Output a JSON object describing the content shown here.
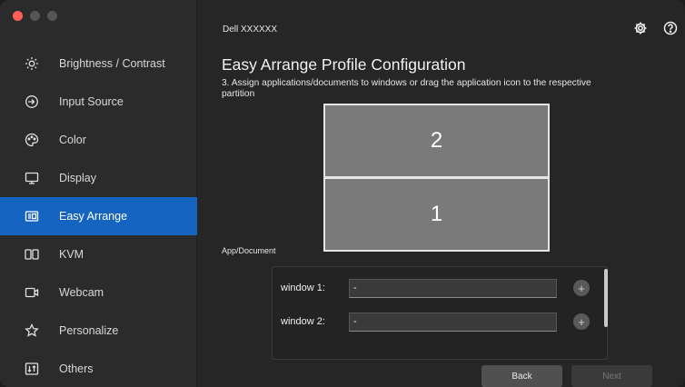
{
  "window": {
    "traffic_lights": [
      "close",
      "minimize",
      "maximize"
    ],
    "colors": {
      "accent": "#1565c0",
      "close": "#ff5f57"
    }
  },
  "header": {
    "title": "Dell XXXXXX",
    "settings_icon": "gear-icon",
    "help_icon": "help-icon"
  },
  "sidebar": {
    "items": [
      {
        "label": "Brightness / Contrast",
        "icon": "brightness-icon",
        "active": false
      },
      {
        "label": "Input Source",
        "icon": "input-source-icon",
        "active": false
      },
      {
        "label": "Color",
        "icon": "color-palette-icon",
        "active": false
      },
      {
        "label": "Display",
        "icon": "display-icon",
        "active": false
      },
      {
        "label": "Easy Arrange",
        "icon": "easy-arrange-icon",
        "active": true
      },
      {
        "label": "KVM",
        "icon": "kvm-icon",
        "active": false
      },
      {
        "label": "Webcam",
        "icon": "webcam-icon",
        "active": false
      },
      {
        "label": "Personalize",
        "icon": "star-icon",
        "active": false
      },
      {
        "label": "Others",
        "icon": "others-icon",
        "active": false
      }
    ]
  },
  "main": {
    "title": "Easy Arrange Profile Configuration",
    "instruction": "3. Assign applications/documents to windows or drag the application icon to the respective partition",
    "partitions": [
      {
        "label": "2"
      },
      {
        "label": "1"
      }
    ],
    "app_document_label": "App/Document",
    "windows": [
      {
        "label": "window 1:",
        "value": "-",
        "add": "+"
      },
      {
        "label": "window 2:",
        "value": "-",
        "add": "+"
      }
    ],
    "buttons": {
      "back": "Back",
      "next": "Next"
    }
  }
}
